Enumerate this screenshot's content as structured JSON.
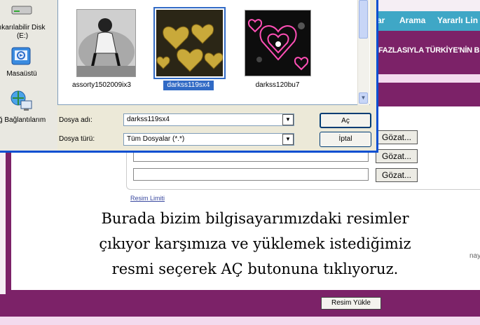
{
  "web": {
    "nav": [
      "ar",
      "Arama",
      "Yararlı Lin"
    ],
    "marquee": "FAZLASIYLA TÜRKİYE'NİN B",
    "gozat_label": "Gözat...",
    "resim_limiti": "Resim Limiti",
    "side_note": "nay",
    "upload_button": "Resim Yükle"
  },
  "desktop": {
    "items": [
      {
        "label": "ıkarılabilir Disk",
        "sub": "(E:)",
        "icon": "drive-icon"
      },
      {
        "label": "Masaüstü",
        "icon": "desktop-icon"
      },
      {
        "label": "ğ Bağlantılarım",
        "icon": "network-icon"
      }
    ]
  },
  "dialog": {
    "files": [
      {
        "name": "assorty1502009ix3",
        "selected": false
      },
      {
        "name": "darkss119sx4",
        "selected": true
      },
      {
        "name": "darkss120bu7",
        "selected": false
      }
    ],
    "filename_label": "Dosya adı:",
    "filename_value": "darkss119sx4",
    "filetype_label": "Dosya türü:",
    "filetype_value": "Tüm Dosyalar (*.*)",
    "open_button": "Aç",
    "cancel_button": "İptal"
  },
  "caption": {
    "line1": "Burada bizim bilgisayarımızdaki resimler",
    "line2": "çıkıyor karşımıza ve yüklemek istediğimiz",
    "line3": "resmi seçerek AÇ butonuna tıklıyoruz."
  },
  "colors": {
    "purple": "#7c2268",
    "nav_blue": "#3fa7c6",
    "selection_blue": "#316ac5",
    "dialog_border": "#0a4fd1"
  }
}
